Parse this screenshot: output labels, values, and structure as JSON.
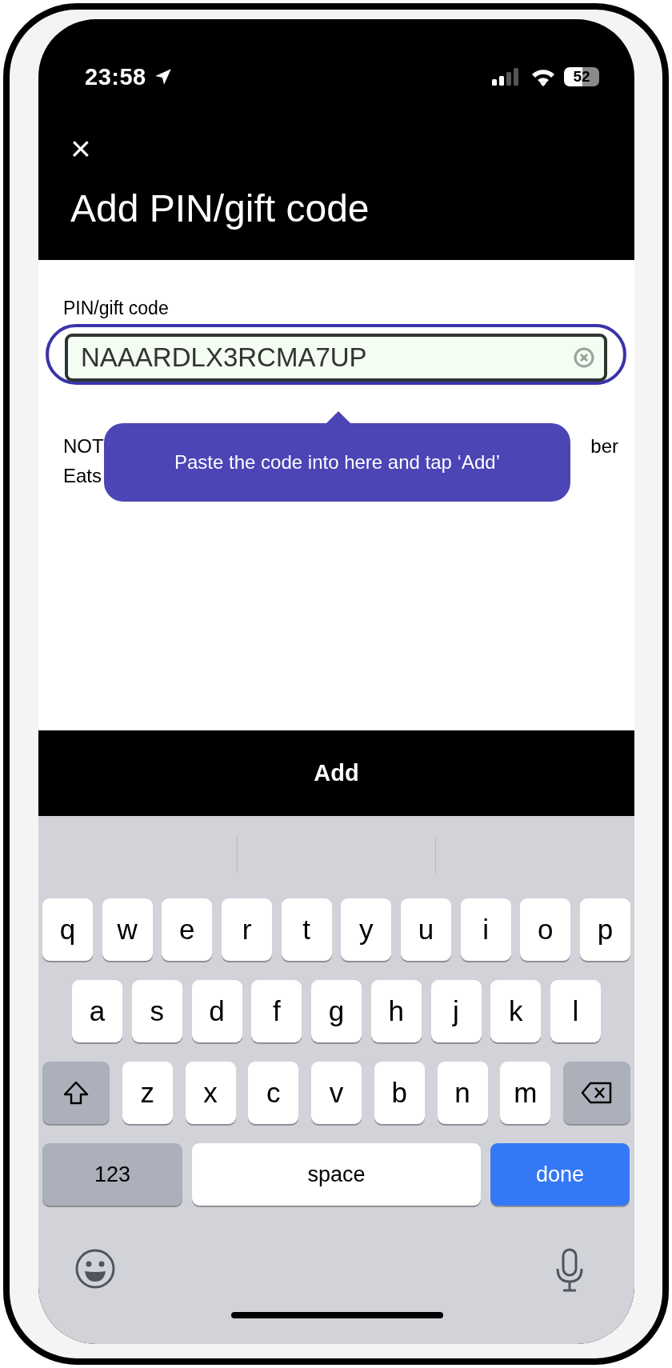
{
  "status_bar": {
    "time": "23:58",
    "battery": "52"
  },
  "header": {
    "close": "×",
    "title": "Add PIN/gift code"
  },
  "code_field": {
    "label": "PIN/gift code",
    "value": "NAAARDLX3RCMA7UP",
    "highlighted": true
  },
  "note": {
    "line_1_start": "NOT",
    "line_1_end": "ber",
    "line_2_start": "Eats"
  },
  "tooltip": {
    "text": "Paste the code into here and tap ‘Add’"
  },
  "add_button": {
    "label": "Add"
  },
  "keyboard": {
    "letter_rows": [
      {
        "keys": [
          {
            "kind": "letter",
            "label": "q"
          },
          {
            "kind": "letter",
            "label": "w"
          },
          {
            "kind": "letter",
            "label": "e"
          },
          {
            "kind": "letter",
            "label": "r"
          },
          {
            "kind": "letter",
            "label": "t"
          },
          {
            "kind": "letter",
            "label": "y"
          },
          {
            "kind": "letter",
            "label": "u"
          },
          {
            "kind": "letter",
            "label": "i"
          },
          {
            "kind": "letter",
            "label": "o"
          },
          {
            "kind": "letter",
            "label": "p"
          }
        ]
      },
      {
        "keys": [
          {
            "kind": "letter",
            "label": "a"
          },
          {
            "kind": "letter",
            "label": "s"
          },
          {
            "kind": "letter",
            "label": "d"
          },
          {
            "kind": "letter",
            "label": "f"
          },
          {
            "kind": "letter",
            "label": "g"
          },
          {
            "kind": "letter",
            "label": "h"
          },
          {
            "kind": "letter",
            "label": "j"
          },
          {
            "kind": "letter",
            "label": "k"
          },
          {
            "kind": "letter",
            "label": "l"
          }
        ]
      },
      {
        "keys": [
          {
            "kind": "shift"
          },
          {
            "kind": "letter",
            "label": "z"
          },
          {
            "kind": "letter",
            "label": "x"
          },
          {
            "kind": "letter",
            "label": "c"
          },
          {
            "kind": "letter",
            "label": "v"
          },
          {
            "kind": "letter",
            "label": "b"
          },
          {
            "kind": "letter",
            "label": "n"
          },
          {
            "kind": "letter",
            "label": "m"
          },
          {
            "kind": "delete"
          }
        ]
      }
    ],
    "bottom_row": {
      "numbers_key": "123",
      "space_key": "space",
      "done_key": "done"
    }
  }
}
